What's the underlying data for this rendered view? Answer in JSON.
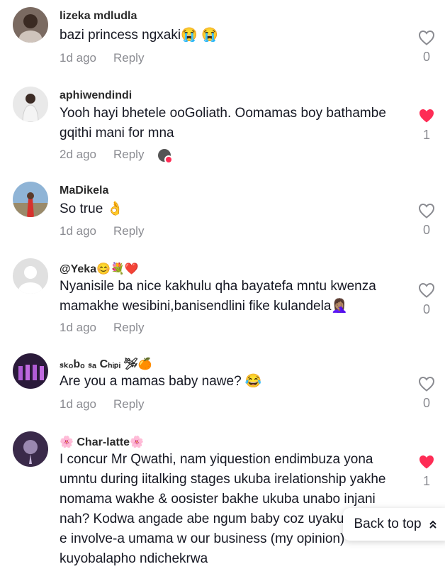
{
  "colors": {
    "liked": "#fe2c55",
    "muted": "#8a8b91",
    "text": "#161823"
  },
  "comments": [
    {
      "username": "lizeka mdludla",
      "text": "bazi princess ngxaki😭 😭",
      "time": "1d ago",
      "reply": "Reply",
      "likes": "0",
      "liked": false
    },
    {
      "username": "aphiwendindi",
      "text": "Yooh hayi bhetele ooGoliath. Oomamas boy bathambe gqithi mani for mna",
      "time": "2d ago",
      "reply": "Reply",
      "likes": "1",
      "liked": true
    },
    {
      "username": "MaDikela",
      "text": "So true 👌",
      "time": "1d ago",
      "reply": "Reply",
      "likes": "0",
      "liked": false
    },
    {
      "username": "@Yeka😊💐❤️",
      "text": "Nyanisile ba nice kakhulu qha bayatefa mntu kwenza mamakhe wesibini,banisendlini fike kulandela🤦🏽‍♀️",
      "time": "1d ago",
      "reply": "Reply",
      "likes": "0",
      "liked": false
    },
    {
      "username": "ₛₖₒbₒ ₛₐ Cₕᵢₚᵢ 🛩🍊",
      "text": "Are you a mamas baby nawe? 😂",
      "time": "1d ago",
      "reply": "Reply",
      "likes": "0",
      "liked": false
    },
    {
      "username": "🌸 Char-latte🌸",
      "text": "I concur Mr Qwathi, nam yiquestion endimbuza yona umntu during iitalking stages ukuba irelationship yakhe nomama wakhe & oosister bakhe ukuba unabo injani nah? Kodwa angade abe ngum baby coz uyakusoloko e involve-a umama w our business (my opinion) kuyobalapho ndichekrwa",
      "likes": "1",
      "liked": true
    }
  ],
  "back_to_top": {
    "label": "Back to top",
    "icon": "double-chevron-up-icon"
  }
}
